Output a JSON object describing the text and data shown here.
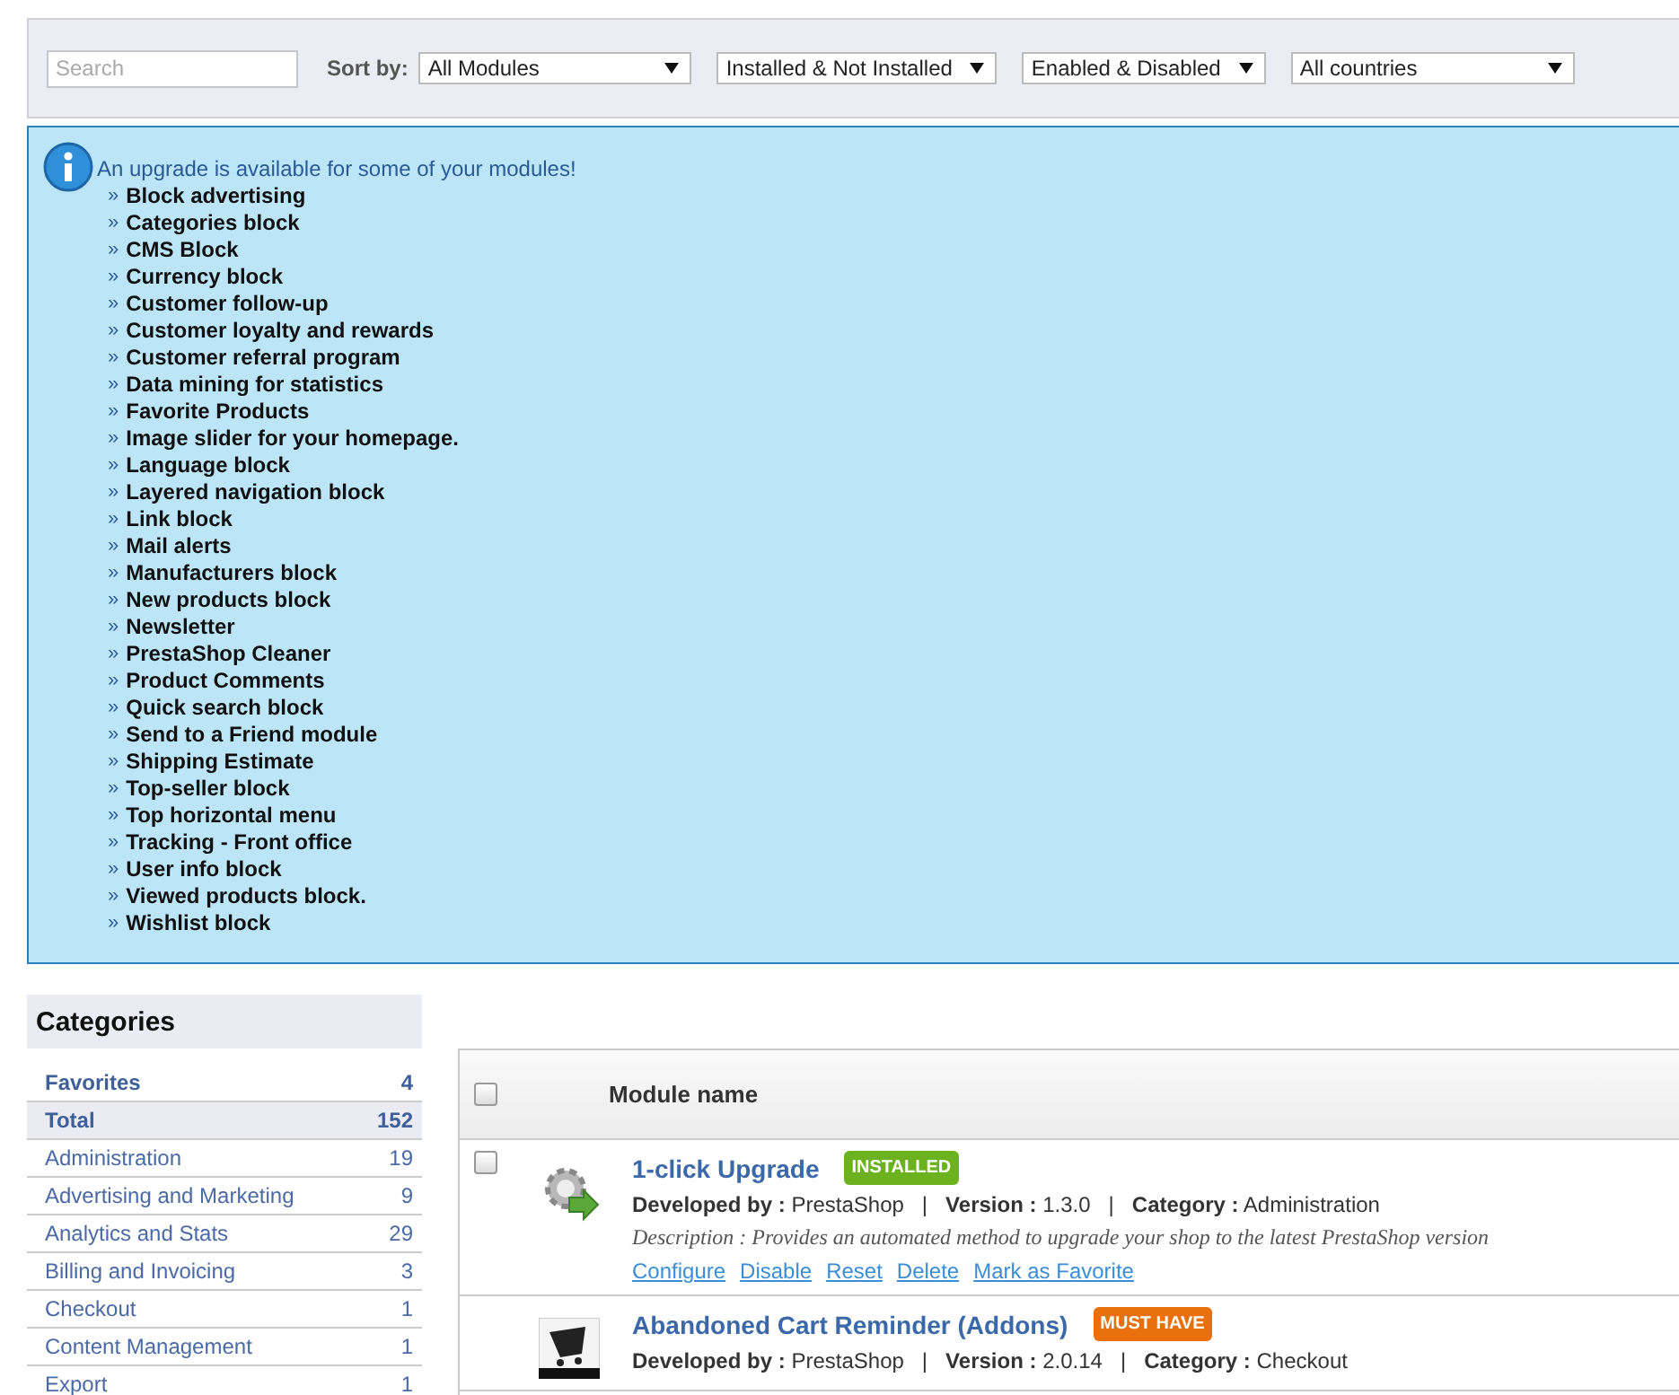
{
  "filters": {
    "search": {
      "placeholder": "Search"
    },
    "sort_label": "Sort by:",
    "selects": [
      {
        "value": "All Modules"
      },
      {
        "value": "Installed & Not Installed"
      },
      {
        "value": "Enabled & Disabled"
      },
      {
        "value": "All countries"
      }
    ]
  },
  "upgrade_notice": {
    "message": "An upgrade is available for some of your modules!",
    "bullet": "»",
    "modules": [
      "Block advertising",
      "Categories block",
      "CMS Block",
      "Currency block",
      "Customer follow-up",
      "Customer loyalty and rewards",
      "Customer referral program",
      "Data mining for statistics",
      "Favorite Products",
      "Image slider for your homepage.",
      "Language block",
      "Layered navigation block",
      "Link block",
      "Mail alerts",
      "Manufacturers block",
      "New products block",
      "Newsletter",
      "PrestaShop Cleaner",
      "Product Comments",
      "Quick search block",
      "Send to a Friend module",
      "Shipping Estimate",
      "Top-seller block",
      "Top horizontal menu",
      "Tracking - Front office",
      "User info block",
      "Viewed products block.",
      "Wishlist block"
    ]
  },
  "categories": {
    "title": "Categories",
    "items": [
      {
        "name": "Favorites",
        "count": "4",
        "kind": "summary",
        "selected": false
      },
      {
        "name": "Total",
        "count": "152",
        "kind": "summary",
        "selected": true
      },
      {
        "name": "Administration",
        "count": "19",
        "kind": "category",
        "selected": false
      },
      {
        "name": "Advertising and Marketing",
        "count": "9",
        "kind": "category",
        "selected": false
      },
      {
        "name": "Analytics and Stats",
        "count": "29",
        "kind": "category",
        "selected": false
      },
      {
        "name": "Billing and Invoicing",
        "count": "3",
        "kind": "category",
        "selected": false
      },
      {
        "name": "Checkout",
        "count": "1",
        "kind": "category",
        "selected": false
      },
      {
        "name": "Content Management",
        "count": "1",
        "kind": "category",
        "selected": false
      },
      {
        "name": "Export",
        "count": "1",
        "kind": "category",
        "selected": false
      }
    ]
  },
  "modules_table": {
    "header": {
      "checked": false,
      "column": "Module name"
    },
    "rows": [
      {
        "checked": false,
        "kind": "gear",
        "name": "1-click Upgrade",
        "separator": "|",
        "badge": {
          "text": "INSTALLED",
          "color": "#6cb11e"
        },
        "developer_label": "Developed by :",
        "developer": "PrestaShop",
        "version_label": "Version :",
        "version": "1.3.0",
        "category_label": "Category :",
        "category": "Administration",
        "description": "Description : Provides an automated method to upgrade your shop to the latest PrestaShop version",
        "actions": [
          "Configure",
          "Disable",
          "Reset",
          "Delete",
          "Mark as Favorite"
        ]
      },
      {
        "kind": "logo",
        "name": "Abandoned Cart Reminder (Addons)",
        "separator": "|",
        "badge": {
          "text": "MUST HAVE",
          "color": "#ea700e"
        },
        "developer_label": "Developed by :",
        "developer": "PrestaShop",
        "version_label": "Version :",
        "version": "2.0.14",
        "category_label": "Category :",
        "category": "Checkout"
      }
    ]
  }
}
